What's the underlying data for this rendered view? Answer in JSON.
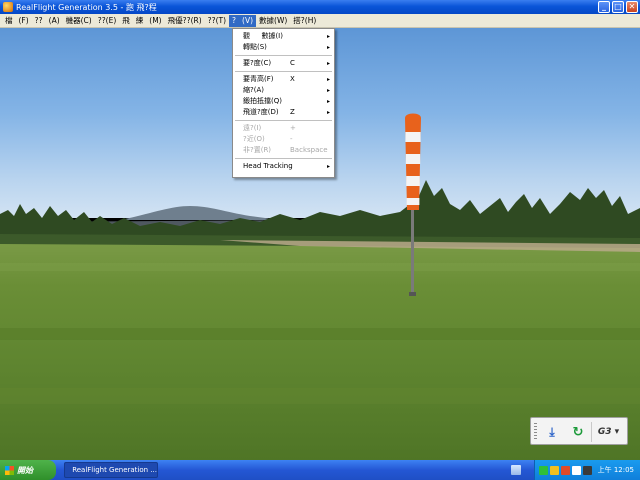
{
  "window": {
    "title": "RealFlight Generation 3.5 -   跑 飛?程",
    "min_glyph": "_",
    "max_glyph": "□",
    "close_glyph": "✕"
  },
  "menubar": {
    "items": [
      {
        "label": "檔"
      },
      {
        "label": "(F)"
      },
      {
        "label": "??"
      },
      {
        "label": "(A)"
      },
      {
        "label": "機器(C)"
      },
      {
        "label": "??(E)"
      },
      {
        "label": "飛"
      },
      {
        "label": "練"
      },
      {
        "label": "(M)"
      },
      {
        "label": "飛優??(R)"
      },
      {
        "label": "??(T)"
      },
      {
        "label": "?"
      },
      {
        "label": "(V)"
      },
      {
        "label": "數據(W)"
      },
      {
        "label": "搭?(H)"
      }
    ],
    "active_index": 12
  },
  "view_menu": {
    "items": [
      {
        "label": "觀 　 數據(I)",
        "shortcut": "",
        "submenu": true,
        "disabled": false
      },
      {
        "label": "轉點(S)",
        "shortcut": "",
        "submenu": true,
        "disabled": false
      },
      {
        "label": "",
        "separator": true
      },
      {
        "label": "要?度(C)",
        "shortcut": "C",
        "submenu": true,
        "disabled": false
      },
      {
        "label": "",
        "separator": true
      },
      {
        "label": "要青高(F)",
        "shortcut": "X",
        "submenu": true,
        "disabled": false
      },
      {
        "label": "縮?(A)",
        "shortcut": "",
        "submenu": true,
        "disabled": false
      },
      {
        "label": "鍛拍抵擋(Q)",
        "shortcut": "",
        "submenu": true,
        "disabled": false
      },
      {
        "label": "飛道?度(D)",
        "shortcut": "Z",
        "submenu": true,
        "disabled": false
      },
      {
        "label": "",
        "separator": true
      },
      {
        "label": "遠?(I)",
        "shortcut": "+",
        "submenu": false,
        "disabled": true
      },
      {
        "label": "?近(O)",
        "shortcut": "-",
        "submenu": false,
        "disabled": true
      },
      {
        "label": "非?置(R)",
        "shortcut": "Backspace",
        "submenu": false,
        "disabled": true
      },
      {
        "label": "",
        "separator": true
      },
      {
        "label": "Head Tracking",
        "shortcut": "",
        "submenu": true,
        "disabled": false
      }
    ],
    "submenu_arrow": "▸"
  },
  "mini_toolbar": {
    "download_glyph": "⤓",
    "refresh_glyph": "↻",
    "g3_label": "G3 ▾"
  },
  "taskbar": {
    "start_label": "開始",
    "app_button_label": "RealFlight Generation ...",
    "clock": "上午 12:05"
  },
  "colors": {
    "titlebar": "#0a55d8",
    "menubar": "#ece9d8",
    "menu_highlight": "#316ac5",
    "windsock_orange": "#e8621c",
    "windsock_white": "#f4f4f4",
    "taskbar": "#2457d4",
    "start_green": "#3a9f35"
  }
}
